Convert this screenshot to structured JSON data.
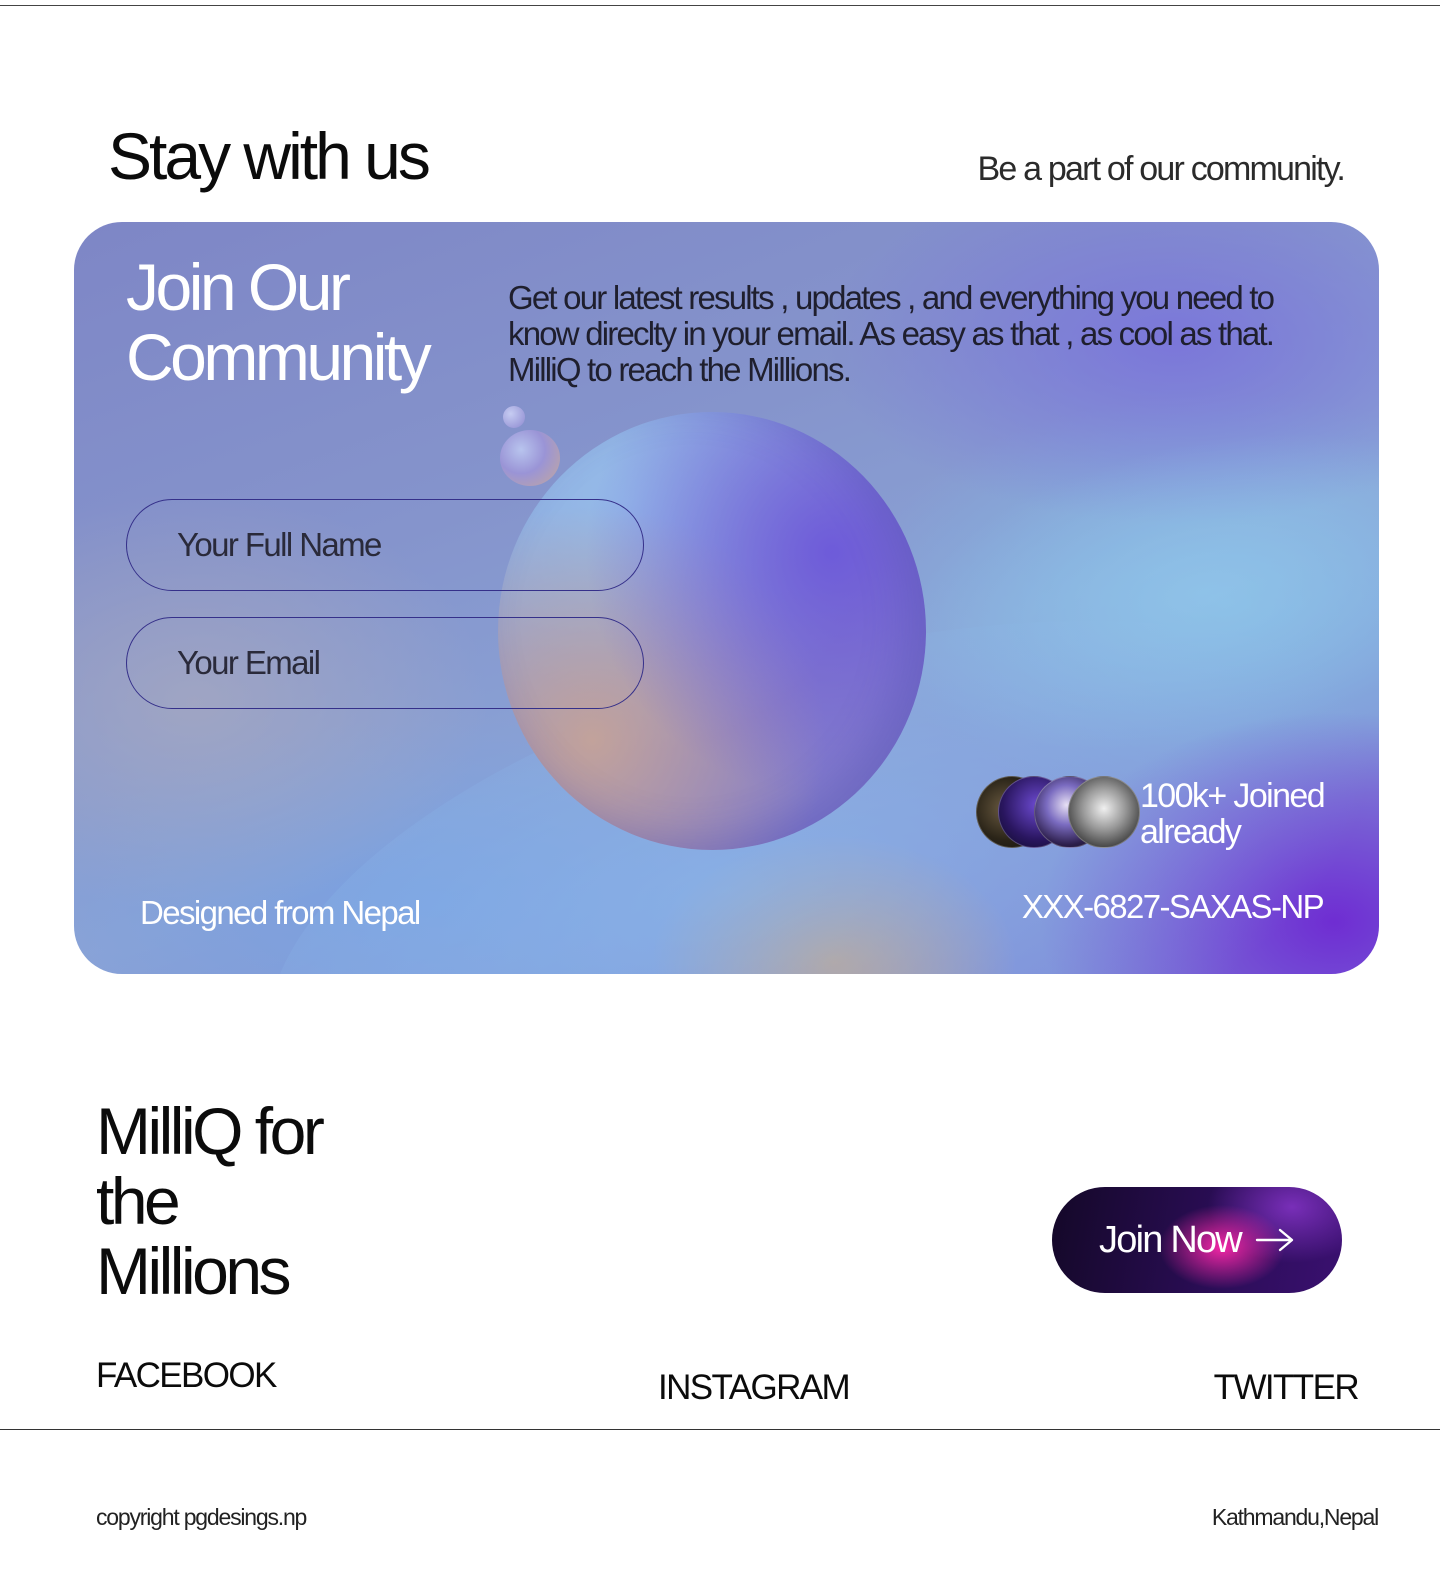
{
  "header": {
    "title": "Stay with us",
    "subtitle": "Be a part of our community."
  },
  "card": {
    "title_line1": "Join Our",
    "title_line2": "Community",
    "description": "Get our latest results , updates , and everything you need to know direclty in your email. As easy as that , as cool as that. MilliQ to reach the Millions.",
    "name_placeholder": "Your Full Name",
    "email_placeholder": "Your Email",
    "name_value": "",
    "email_value": "",
    "designed_from": "Designed from Nepal",
    "joined_line1": "100k+ Joined",
    "joined_line2": "already",
    "code": "XXX-6827-SAXAS-NP"
  },
  "cta": {
    "headline_line1": "MilliQ for",
    "headline_line2": "the",
    "headline_line3": "Millions",
    "button_label": "Join Now",
    "button_icon": "arrow-right-icon"
  },
  "social": {
    "facebook": "FACEBOOK",
    "instagram": "INSTAGRAM",
    "twitter": "TWITTER"
  },
  "footer": {
    "copyright": "copyright pgdesings.np",
    "location": "Kathmandu,Nepal"
  },
  "colors": {
    "button_bg": "#2a0d55",
    "button_glow": "#ff28aa",
    "field_border": "#35308a",
    "card_accent": "#6e28d2"
  }
}
